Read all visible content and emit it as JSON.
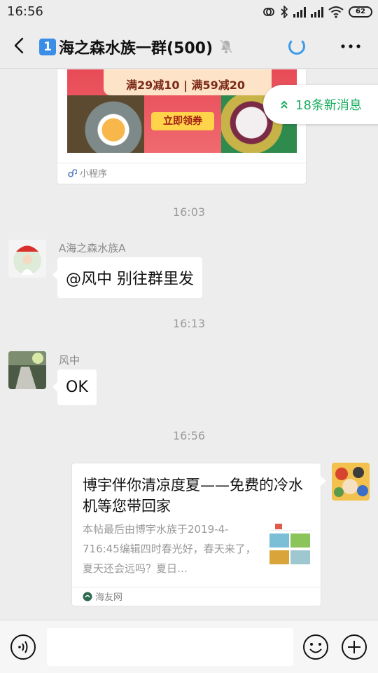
{
  "status_bar": {
    "time": "16:56",
    "battery": "62"
  },
  "header": {
    "badge_number": "1",
    "title": "海之森水族一群(500)"
  },
  "new_messages": {
    "label": "18条新消息"
  },
  "messages": {
    "promo_card": {
      "promo_text": "满29减10 | 满59减20",
      "promo_button": "立即领券",
      "source_label": "小程序"
    },
    "time_1": "16:03",
    "msg_1": {
      "sender": "A海之森水族A",
      "text": "@风中  别往群里发"
    },
    "time_2": "16:13",
    "msg_2": {
      "sender": "风中",
      "text": "OK"
    },
    "time_3": "16:56",
    "link_card": {
      "title": "博宇伴你清凉度夏——免费的冷水机等您带回家",
      "description": "本帖最后由博宇水族于2019-4-716:45编辑四时春光好，春天来了，夏天还会远吗？夏日…",
      "source": "海友网"
    }
  },
  "input_bar": {
    "placeholder": ""
  },
  "colors": {
    "accent_green": "#1aad60",
    "loading_blue": "#3a9be8",
    "background": "#ededed"
  }
}
